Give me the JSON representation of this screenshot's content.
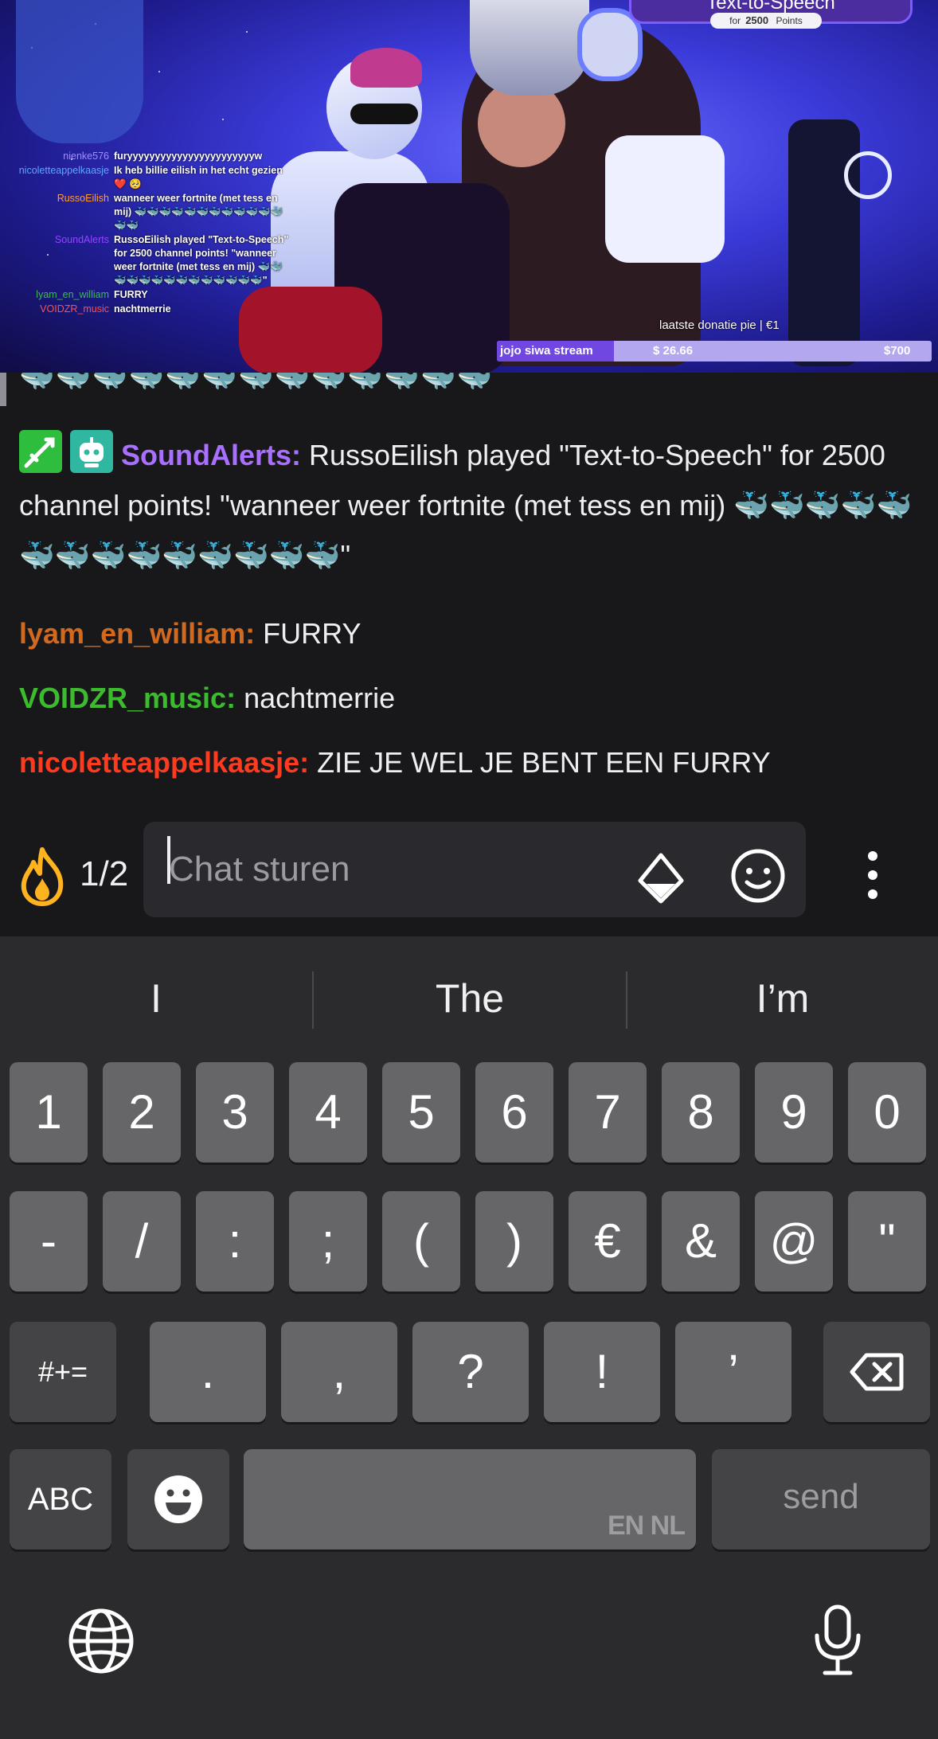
{
  "stream": {
    "tts_title": "Text-to-Speech",
    "tts_for": "for",
    "tts_points": "2500",
    "tts_points_label": "Points",
    "donation_label": "laatste donatie   pie |  €1",
    "goal_name": "jojo siwa stream",
    "goal_current": "$ 26.66",
    "goal_target": "$700",
    "goal_progress_pct": 27,
    "overlay_chat": [
      {
        "user": "nienke576",
        "color": "#a58bff",
        "message": "furyyyyyyyyyyyyyyyyyyyyyyyw"
      },
      {
        "user": "nicoletteappelkaasje",
        "color": "#5aa8ff",
        "message": "Ik heb billie eilish in het echt gezien ❤️ 🥺"
      },
      {
        "user": "RussoEilish",
        "color": "#ff9a3c",
        "message": "wanneer weer fortnite (met tess en mij) 🐳🐳🐳🐳🐳🐳🐳🐳🐳🐳🐳🐳🐳🐳"
      },
      {
        "user": "SoundAlerts",
        "color": "#9147ff",
        "message": "RussoEilish played \"Text-to-Speech\" for 2500 channel points! \"wanneer weer fortnite (met tess en mij) 🐳🐳🐳🐳🐳🐳🐳🐳🐳🐳🐳🐳🐳🐳\""
      },
      {
        "user": "lyam_en_william",
        "color": "#3dbb52",
        "message": "FURRY"
      },
      {
        "user": "VOIDZR_music",
        "color": "#ff4f4f",
        "message": "nachtmerrie"
      }
    ]
  },
  "chat": {
    "whales_top": "🐳🐳🐳🐳🐳🐳🐳🐳🐳🐳🐳🐳🐳",
    "messages": [
      {
        "user": "SoundAlerts:",
        "color": "#a970ff",
        "text": " RussoEilish played \"Text-to-Speech\" for 2500 channel points! \"wanneer weer fortnite (met tess en mij) 🐳🐳🐳🐳🐳🐳🐳🐳🐳🐳🐳🐳🐳🐳\""
      },
      {
        "user": "lyam_en_william:",
        "color": "#d2691e",
        "text": " FURRY"
      },
      {
        "user": "VOIDZR_music:",
        "color": "#3dbb2e",
        "text": " nachtmerrie"
      },
      {
        "user": "nicoletteappelkaasje:",
        "color": "#ff3b1f",
        "text": " ZIE JE WEL JE BENT EEN FURRY"
      }
    ],
    "badge_sword_icon": "sword-icon",
    "badge_robot_icon": "robot-icon",
    "counter": "1/2",
    "input_placeholder": "Chat sturen"
  },
  "keyboard": {
    "suggestions": [
      "I",
      "The",
      "I’m"
    ],
    "row1": [
      "1",
      "2",
      "3",
      "4",
      "5",
      "6",
      "7",
      "8",
      "9",
      "0"
    ],
    "row2": [
      "-",
      "/",
      ":",
      ";",
      "(",
      ")",
      "€",
      "&",
      "@",
      "\""
    ],
    "row3_mode": "#+=",
    "row3": [
      ".",
      ",",
      "?",
      "!",
      "’"
    ],
    "abc_label": "ABC",
    "space_label": "EN NL",
    "send_label": "send"
  }
}
